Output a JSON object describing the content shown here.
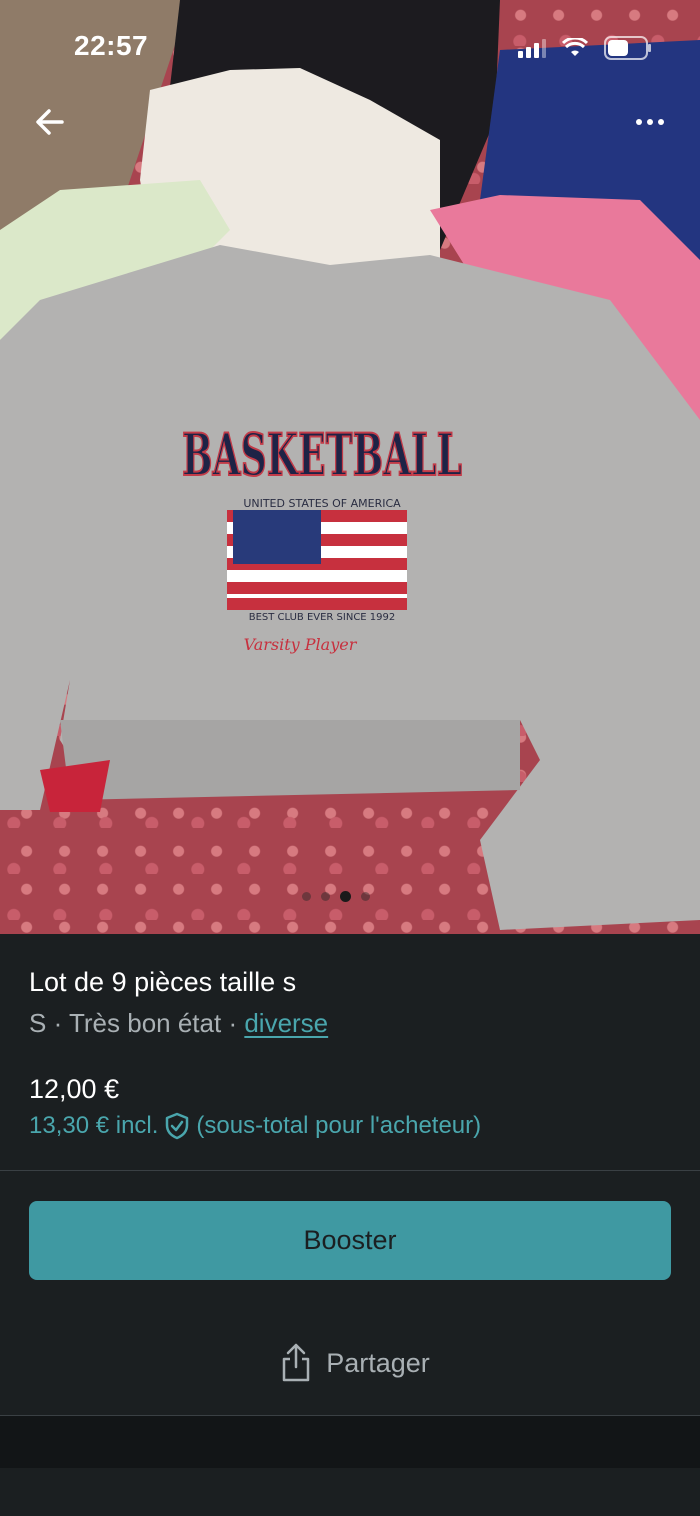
{
  "status_bar": {
    "time": "22:57"
  },
  "photo": {
    "carousel_dots": 4,
    "active_dot": 3
  },
  "listing": {
    "title": "Lot de 9 pièces taille s",
    "size": "S",
    "separator": " · ",
    "condition": "Très bon état",
    "brand": "diverse",
    "price": "12,00 €",
    "price_incl": "13,30 € incl.",
    "price_incl_note": "(sous-total pour l'acheteur)"
  },
  "actions": {
    "booster_label": "Booster",
    "share_label": "Partager"
  },
  "colors": {
    "accent": "#3f99a2",
    "link": "#4aa6ad",
    "background": "#1b1f21"
  }
}
